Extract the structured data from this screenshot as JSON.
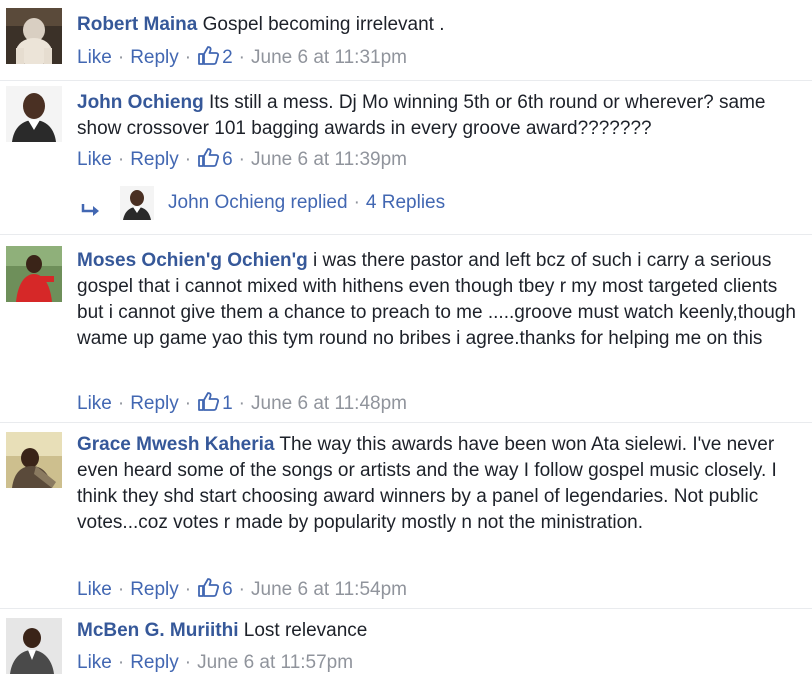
{
  "comments": [
    {
      "author": "Robert Maina",
      "text": "Gospel becoming irrelevant .",
      "like": "Like",
      "reply": "Reply",
      "likes": "2",
      "time": "June 6 at 11:31pm"
    },
    {
      "author": "John Ochieng",
      "text": "Its still a mess. Dj Mo winning 5th or 6th round or wherever? same show crossover 101 bagging awards in every groove award???????",
      "like": "Like",
      "reply": "Reply",
      "likes": "6",
      "time": "June 6 at 11:39pm",
      "replies_summary": {
        "label": "John Ochieng replied",
        "count": "4 Replies"
      }
    },
    {
      "author": "Moses Ochien'g Ochien'g",
      "text": "i was there pastor and left bcz of such i carry a serious gospel that i cannot mixed with hithens even though tbey r my most targeted clients but i cannot give them a chance to preach to me .....groove must watch keenly,though wame up game yao this tym round no bribes i agree.thanks for helping me on this",
      "like": "Like",
      "reply": "Reply",
      "likes": "1",
      "time": "June 6 at 11:48pm"
    },
    {
      "author": "Grace Mwesh Kaheria",
      "text": "The way this awards have been won Ata sielewi. I've never even heard some of the songs or artists and the way I follow gospel music closely. I think they shd start choosing award winners by a panel of legendaries. Not public votes...coz votes r made by popularity mostly n not the ministration.",
      "like": "Like",
      "reply": "Reply",
      "likes": "6",
      "time": "June 6 at 11:54pm"
    },
    {
      "author": "McBen G. Muriithi",
      "text": "Lost relevance",
      "like": "Like",
      "reply": "Reply",
      "time": "June 6 at 11:57pm"
    }
  ],
  "colors": {
    "author": "#365899",
    "link": "#4267b2",
    "meta": "#90949c",
    "text": "#1d2129"
  },
  "icons": {
    "like": "thumbs-up-icon",
    "reply_arrow": "reply-arrow-icon"
  }
}
